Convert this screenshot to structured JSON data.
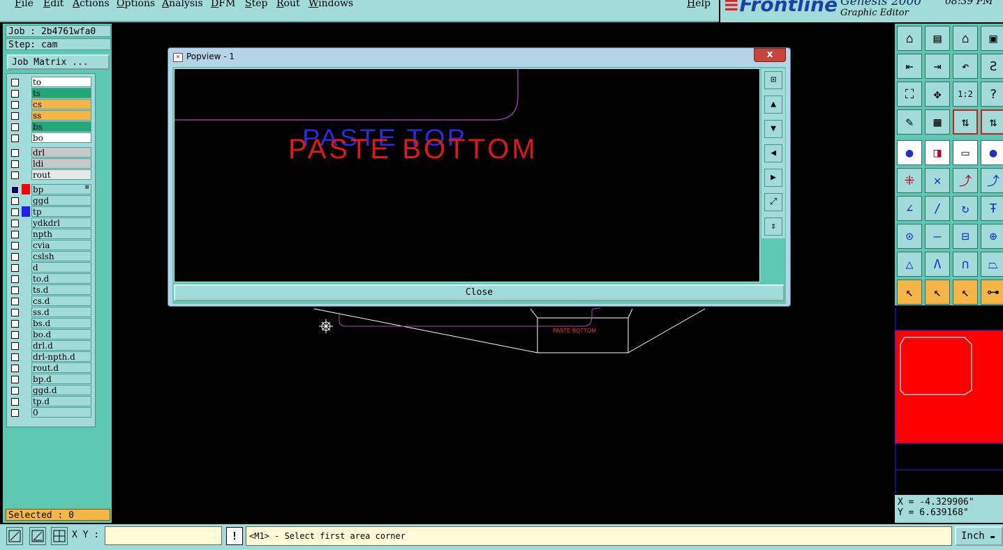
{
  "menu": [
    "File",
    "Edit",
    "Actions",
    "Options",
    "Analysis",
    "DFM",
    "Step",
    "Rout",
    "Windows"
  ],
  "help": "Help",
  "brand": {
    "logo": "Frontline",
    "product": "Genesis 2000",
    "subtitle": "Graphic Editor",
    "time": "08:39 PM"
  },
  "job": {
    "label": "Job : 2b4761wfa0",
    "step": "Step: cam",
    "matrix_button": "Job Matrix ..."
  },
  "layers": [
    {
      "name": "to",
      "bg": "#ffffff",
      "swatch": ""
    },
    {
      "name": "ts",
      "bg": "#20a878",
      "swatch": ""
    },
    {
      "name": "cs",
      "bg": "#f5b547",
      "swatch": ""
    },
    {
      "name": "ss",
      "bg": "#f5b547",
      "swatch": ""
    },
    {
      "name": "bs",
      "bg": "#20a878",
      "swatch": ""
    },
    {
      "name": "bo",
      "bg": "#ffffff",
      "swatch": ""
    },
    {
      "name": "drl",
      "bg": "#c8c8c8",
      "swatch": ""
    },
    {
      "name": "ldi",
      "bg": "#c8c8c8",
      "swatch": ""
    },
    {
      "name": "rout",
      "bg": "#e8e8e8",
      "swatch": ""
    },
    {
      "name": "bp",
      "bg": "#a2dcda",
      "swatch": "#ff0000",
      "active": true
    },
    {
      "name": "ggd",
      "bg": "#a2dcda",
      "swatch": ""
    },
    {
      "name": "tp",
      "bg": "#a2dcda",
      "swatch": "#2020ff"
    },
    {
      "name": "ydkdrl",
      "bg": "#a2dcda",
      "swatch": ""
    },
    {
      "name": "npth",
      "bg": "#a2dcda",
      "swatch": ""
    },
    {
      "name": "cvia",
      "bg": "#a2dcda",
      "swatch": ""
    },
    {
      "name": "cslsh",
      "bg": "#a2dcda",
      "swatch": ""
    },
    {
      "name": "d",
      "bg": "#a2dcda",
      "swatch": ""
    },
    {
      "name": "to.d",
      "bg": "#a2dcda",
      "swatch": ""
    },
    {
      "name": "ts.d",
      "bg": "#a2dcda",
      "swatch": ""
    },
    {
      "name": "cs.d",
      "bg": "#a2dcda",
      "swatch": ""
    },
    {
      "name": "ss.d",
      "bg": "#a2dcda",
      "swatch": ""
    },
    {
      "name": "bs.d",
      "bg": "#a2dcda",
      "swatch": ""
    },
    {
      "name": "bo.d",
      "bg": "#a2dcda",
      "swatch": ""
    },
    {
      "name": "drl.d",
      "bg": "#a2dcda",
      "swatch": ""
    },
    {
      "name": "drl-npth.d",
      "bg": "#a2dcda",
      "swatch": ""
    },
    {
      "name": "rout.d",
      "bg": "#a2dcda",
      "swatch": ""
    },
    {
      "name": "bp.d",
      "bg": "#a2dcda",
      "swatch": ""
    },
    {
      "name": "ggd.d",
      "bg": "#a2dcda",
      "swatch": ""
    },
    {
      "name": "tp.d",
      "bg": "#a2dcda",
      "swatch": ""
    },
    {
      "name": "0",
      "bg": "#a2dcda",
      "swatch": ""
    }
  ],
  "selected": "Selected : 0",
  "popup": {
    "title": "Popview - 1",
    "close_x": "x",
    "close_button": "Close",
    "text_top": "PASTE TOP",
    "text_bottom": "PASTE BOTTOM"
  },
  "main_canvas": {
    "small_text": "PASTE BOTTOM"
  },
  "coords": {
    "x": "X = -4.329906\"",
    "y": "Y =  6.639168\""
  },
  "status": {
    "xy_label": "X Y :",
    "xy_value": "",
    "excl": "!",
    "message": "<M1> - Select first area corner",
    "units": "Inch"
  },
  "colors": {
    "panel": "#a2dcda",
    "panel_dark": "#5cc8b2",
    "accent_orange": "#f5b547",
    "bottom_layer": "#ff0000",
    "top_layer": "#2020ff",
    "outline": "#c040c0"
  }
}
